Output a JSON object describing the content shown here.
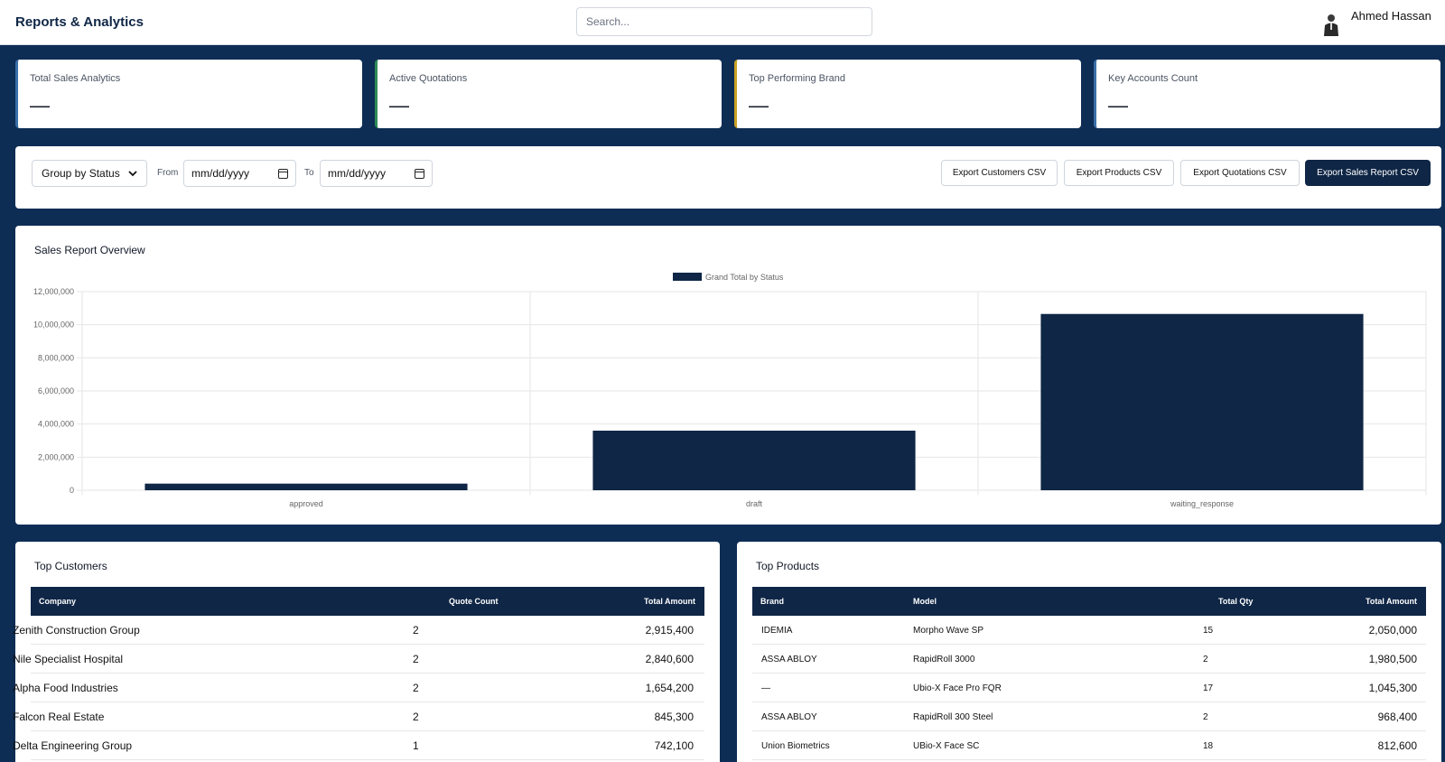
{
  "header": {
    "title": "Reports & Analytics",
    "search_placeholder": "Search...",
    "user_name": "Ahmed Hassan"
  },
  "kpis": [
    {
      "label": "Total Sales Analytics",
      "value": "—"
    },
    {
      "label": "Active Quotations",
      "value": "—"
    },
    {
      "label": "Top Performing Brand",
      "value": "—"
    },
    {
      "label": "Key Accounts Count",
      "value": "—"
    }
  ],
  "filters": {
    "group_by": "Group by Status",
    "from_label": "From",
    "from_value": "mm/dd/yyyy",
    "to_label": "To",
    "to_value": "mm/dd/yyyy",
    "buttons": [
      "Export Customers CSV",
      "Export Products CSV",
      "Export Quotations CSV",
      "Export Sales Report CSV"
    ]
  },
  "chart_panel": {
    "title": "Sales Report Overview"
  },
  "chart_data": {
    "type": "bar",
    "categories": [
      "approved",
      "draft",
      "waiting_response"
    ],
    "series": [
      {
        "name": "Grand Total by Status",
        "values": [
          400000,
          3600000,
          10650000
        ]
      }
    ],
    "ylim": [
      0,
      12000000
    ],
    "yticks": [
      "12,000,000",
      "10,000,000",
      "8,000,000",
      "6,000,000",
      "4,000,000",
      "2,000,000",
      "0"
    ],
    "grid": true,
    "legend": "top-center",
    "color": "#0f2646"
  },
  "customers": {
    "title": "Top Customers",
    "columns": [
      "Company",
      "Quote Count",
      "Total Amount"
    ],
    "rows": [
      {
        "company": "Zenith Construction Group",
        "count": "2",
        "amount": "2,915,400"
      },
      {
        "company": "Nile Specialist Hospital",
        "count": "2",
        "amount": "2,840,600"
      },
      {
        "company": "Alpha Food Industries",
        "count": "2",
        "amount": "1,654,200"
      },
      {
        "company": "Falcon Real Estate",
        "count": "2",
        "amount": "845,300"
      },
      {
        "company": "Delta Engineering Group",
        "count": "1",
        "amount": "742,100"
      }
    ]
  },
  "products": {
    "title": "Top Products",
    "columns": [
      "Brand",
      "Model",
      "Total Qty",
      "Total Amount"
    ],
    "rows": [
      {
        "brand": "IDEMIA",
        "model": "Morpho Wave SP",
        "qty": "15",
        "amount": "2,050,000"
      },
      {
        "brand": "ASSA ABLOY",
        "model": "RapidRoll 3000",
        "qty": "2",
        "amount": "1,980,500"
      },
      {
        "brand": "—",
        "model": "Ubio-X Face Pro FQR",
        "qty": "17",
        "amount": "1,045,300"
      },
      {
        "brand": "ASSA ABLOY",
        "model": "RapidRoll 300 Steel",
        "qty": "2",
        "amount": "968,400"
      },
      {
        "brand": "Union Biometrics",
        "model": "UBio-X Face SC",
        "qty": "18",
        "amount": "812,600"
      }
    ]
  }
}
